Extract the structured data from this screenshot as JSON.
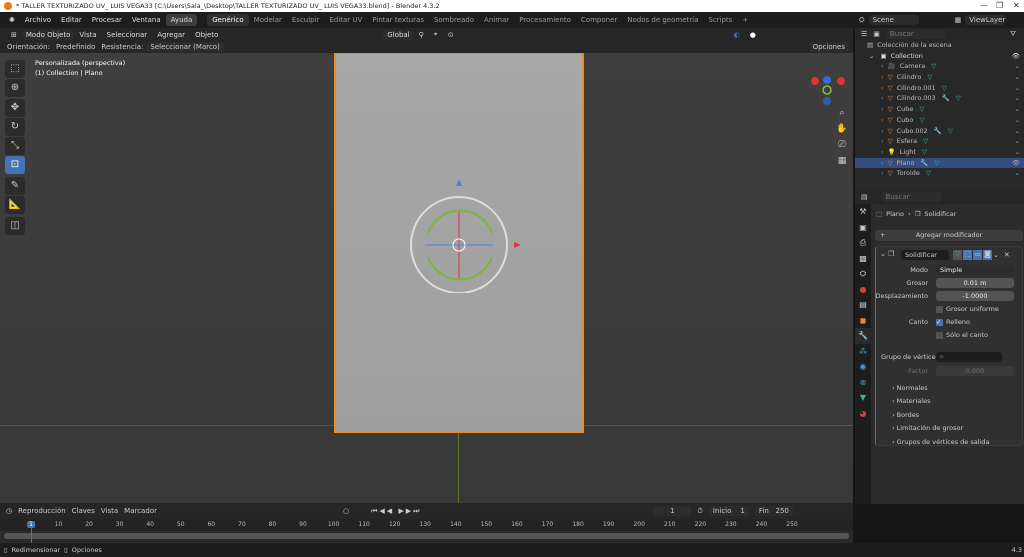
{
  "window": {
    "title": "* TALLER TEXTURIZADO UV_ LUIS VEGA33 [C:\\Users\\Sala_\\Desktop\\TALLER TEXTURIZADO UV_ LUIS VEGA33.blend] - Blender 4.3.2",
    "minimize": "—",
    "restore": "❐",
    "close": "✕"
  },
  "menu": [
    "Archivo",
    "Editar",
    "Procesar",
    "Ventana",
    "Ayuda"
  ],
  "workspaces": [
    "Genérico",
    "Modelar",
    "Esculpir",
    "Editar UV",
    "Pintar texturas",
    "Sombreado",
    "Animar",
    "Procesamiento",
    "Componer",
    "Nodos de geometría",
    "Scripts"
  ],
  "add_workspace": "+",
  "scene": {
    "name": "Scene",
    "view_layer": "ViewLayer"
  },
  "viewport_header": {
    "mode": "Modo Objeto",
    "items": [
      "Vista",
      "Seleccionar",
      "Agregar",
      "Objeto"
    ],
    "orientation_global": "Global",
    "options": "Opciones"
  },
  "tool_settings": {
    "orientation_label": "Orientación:",
    "orientation_value": "Predefinido",
    "drag_label": "Resistencia:",
    "drag_value": "Seleccionar (Marco)"
  },
  "viewport": {
    "view_name": "Personalizada (perspectiva)",
    "context": "(1) Collection | Plano"
  },
  "outliner": {
    "search_placeholder": "Buscar",
    "scene_collection": "Colección de la escena",
    "collection": "Collection",
    "items": [
      {
        "name": "Camera",
        "type": "camera"
      },
      {
        "name": "Cilindro",
        "type": "mesh"
      },
      {
        "name": "Cilindro.001",
        "type": "mesh"
      },
      {
        "name": "Cilindro.003",
        "type": "mesh",
        "modifier": true
      },
      {
        "name": "Cube",
        "type": "mesh"
      },
      {
        "name": "Cubo",
        "type": "mesh"
      },
      {
        "name": "Cubo.002",
        "type": "mesh",
        "modifier": true
      },
      {
        "name": "Esfera",
        "type": "mesh"
      },
      {
        "name": "Light",
        "type": "light"
      },
      {
        "name": "Plano",
        "type": "mesh",
        "modifier": true,
        "selected": true
      },
      {
        "name": "Toroide",
        "type": "mesh"
      }
    ]
  },
  "properties": {
    "search_placeholder": "Buscar",
    "breadcrumb_object": "Plano",
    "breadcrumb_modifier": "Solidificar",
    "add_modifier": "Agregar modificador",
    "modifier": {
      "name": "Solidificar",
      "mode_label": "Modo",
      "mode_value": "Simple",
      "thickness_label": "Grosor",
      "thickness_value": "0.01 m",
      "offset_label": "Desplazamiento",
      "offset_value": "-1.0000",
      "even_thickness": "Grosor uniforme",
      "rim_label": "Canto",
      "rim_fill": "Relleno",
      "rim_only": "Sólo el canto",
      "vgroup_label": "Grupo de vértices",
      "factor_label": "Factor",
      "factor_value": "0.000",
      "subpanels": [
        "Normales",
        "Materiales",
        "Bordes",
        "Limitación de grosor",
        "Grupos de vértices de salida"
      ]
    }
  },
  "timeline": {
    "menus": [
      "Reproducción",
      "Claves",
      "Vista",
      "Marcador"
    ],
    "current_frame": "1",
    "start_label": "Inicio",
    "start": "1",
    "end_label": "Fin",
    "end": "250",
    "ticks": [
      "1",
      "10",
      "20",
      "30",
      "40",
      "50",
      "60",
      "70",
      "80",
      "90",
      "100",
      "110",
      "120",
      "130",
      "140",
      "150",
      "160",
      "170",
      "180",
      "190",
      "200",
      "210",
      "220",
      "230",
      "240",
      "250"
    ]
  },
  "status": {
    "left1": "Redimensionar",
    "left2": "Opciones",
    "version": "4.3"
  },
  "colors": {
    "accent": "#4772b3",
    "selection": "#f08d1c",
    "object_icon": "#e7873a"
  }
}
